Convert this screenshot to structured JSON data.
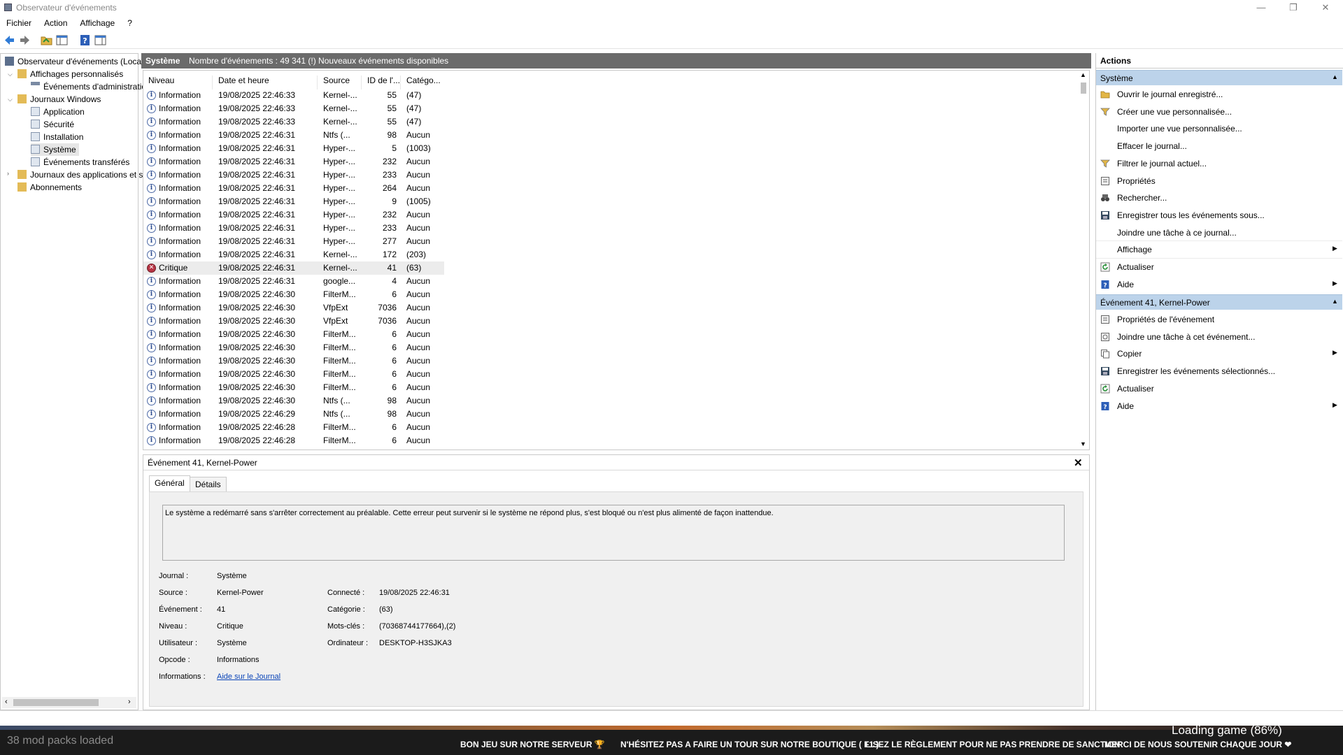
{
  "window": {
    "title": "Observateur d'événements",
    "minimize_label": "—",
    "restore_label": "❐",
    "close_label": "✕"
  },
  "menu": [
    "Fichier",
    "Action",
    "Affichage",
    "?"
  ],
  "tree": {
    "root": "Observateur d'événements (Local)",
    "custom_views": "Affichages personnalisés",
    "admin_events": "Événements d'administration",
    "windows_logs": "Journaux Windows",
    "application": "Application",
    "security": "Sécurité",
    "setup": "Installation",
    "system": "Système",
    "forwarded": "Événements transférés",
    "app_services_logs": "Journaux des applications et services",
    "subscriptions": "Abonnements"
  },
  "list_header": {
    "log_name": "Système",
    "summary": "Nombre d'événements : 49 341 (!) Nouveaux événements disponibles"
  },
  "columns": [
    "Niveau",
    "Date et heure",
    "Source",
    "ID de l'...",
    "Catégo..."
  ],
  "rows": [
    {
      "level": "Information",
      "date": "19/08/2025 22:46:33",
      "source": "Kernel-...",
      "id": "55",
      "cat": "(47)"
    },
    {
      "level": "Information",
      "date": "19/08/2025 22:46:33",
      "source": "Kernel-...",
      "id": "55",
      "cat": "(47)"
    },
    {
      "level": "Information",
      "date": "19/08/2025 22:46:33",
      "source": "Kernel-...",
      "id": "55",
      "cat": "(47)"
    },
    {
      "level": "Information",
      "date": "19/08/2025 22:46:31",
      "source": "Ntfs (...",
      "id": "98",
      "cat": "Aucun"
    },
    {
      "level": "Information",
      "date": "19/08/2025 22:46:31",
      "source": "Hyper-...",
      "id": "5",
      "cat": "(1003)"
    },
    {
      "level": "Information",
      "date": "19/08/2025 22:46:31",
      "source": "Hyper-...",
      "id": "232",
      "cat": "Aucun"
    },
    {
      "level": "Information",
      "date": "19/08/2025 22:46:31",
      "source": "Hyper-...",
      "id": "233",
      "cat": "Aucun"
    },
    {
      "level": "Information",
      "date": "19/08/2025 22:46:31",
      "source": "Hyper-...",
      "id": "264",
      "cat": "Aucun"
    },
    {
      "level": "Information",
      "date": "19/08/2025 22:46:31",
      "source": "Hyper-...",
      "id": "9",
      "cat": "(1005)"
    },
    {
      "level": "Information",
      "date": "19/08/2025 22:46:31",
      "source": "Hyper-...",
      "id": "232",
      "cat": "Aucun"
    },
    {
      "level": "Information",
      "date": "19/08/2025 22:46:31",
      "source": "Hyper-...",
      "id": "233",
      "cat": "Aucun"
    },
    {
      "level": "Information",
      "date": "19/08/2025 22:46:31",
      "source": "Hyper-...",
      "id": "277",
      "cat": "Aucun"
    },
    {
      "level": "Information",
      "date": "19/08/2025 22:46:31",
      "source": "Kernel-...",
      "id": "172",
      "cat": "(203)"
    },
    {
      "level": "Critique",
      "date": "19/08/2025 22:46:31",
      "source": "Kernel-...",
      "id": "41",
      "cat": "(63)"
    },
    {
      "level": "Information",
      "date": "19/08/2025 22:46:31",
      "source": "google...",
      "id": "4",
      "cat": "Aucun"
    },
    {
      "level": "Information",
      "date": "19/08/2025 22:46:30",
      "source": "FilterM...",
      "id": "6",
      "cat": "Aucun"
    },
    {
      "level": "Information",
      "date": "19/08/2025 22:46:30",
      "source": "VfpExt",
      "id": "7036",
      "cat": "Aucun"
    },
    {
      "level": "Information",
      "date": "19/08/2025 22:46:30",
      "source": "VfpExt",
      "id": "7036",
      "cat": "Aucun"
    },
    {
      "level": "Information",
      "date": "19/08/2025 22:46:30",
      "source": "FilterM...",
      "id": "6",
      "cat": "Aucun"
    },
    {
      "level": "Information",
      "date": "19/08/2025 22:46:30",
      "source": "FilterM...",
      "id": "6",
      "cat": "Aucun"
    },
    {
      "level": "Information",
      "date": "19/08/2025 22:46:30",
      "source": "FilterM...",
      "id": "6",
      "cat": "Aucun"
    },
    {
      "level": "Information",
      "date": "19/08/2025 22:46:30",
      "source": "FilterM...",
      "id": "6",
      "cat": "Aucun"
    },
    {
      "level": "Information",
      "date": "19/08/2025 22:46:30",
      "source": "FilterM...",
      "id": "6",
      "cat": "Aucun"
    },
    {
      "level": "Information",
      "date": "19/08/2025 22:46:30",
      "source": "Ntfs (...",
      "id": "98",
      "cat": "Aucun"
    },
    {
      "level": "Information",
      "date": "19/08/2025 22:46:29",
      "source": "Ntfs (...",
      "id": "98",
      "cat": "Aucun"
    },
    {
      "level": "Information",
      "date": "19/08/2025 22:46:28",
      "source": "FilterM...",
      "id": "6",
      "cat": "Aucun"
    },
    {
      "level": "Information",
      "date": "19/08/2025 22:46:28",
      "source": "FilterM...",
      "id": "6",
      "cat": "Aucun"
    }
  ],
  "detail": {
    "title": "Événement 41, Kernel-Power",
    "close_label": "✕",
    "tab_general": "Général",
    "tab_details": "Détails",
    "description": "Le système a redémarré sans s'arrêter correctement au préalable. Cette erreur peut survenir si le système ne répond plus, s'est bloqué ou n'est plus alimenté de façon inattendue.",
    "labels": {
      "journal": "Journal :",
      "source": "Source :",
      "event": "Événement :",
      "level": "Niveau :",
      "user": "Utilisateur :",
      "opcode": "Opcode :",
      "info": "Informations :",
      "logged": "Connecté :",
      "category": "Catégorie :",
      "keywords": "Mots-clés :",
      "computer": "Ordinateur :"
    },
    "values": {
      "journal": "Système",
      "source": "Kernel-Power",
      "event": "41",
      "level": "Critique",
      "user": "Système",
      "opcode": "Informations",
      "info_link": "Aide sur le Journal",
      "logged": "19/08/2025 22:46:31",
      "category": "(63)",
      "keywords": "(70368744177664),(2)",
      "computer": "DESKTOP-H3SJKA3"
    }
  },
  "actions": {
    "title": "Actions",
    "section1": "Système",
    "items1": [
      {
        "label": "Ouvrir le journal enregistré...",
        "icon": "folder-icon"
      },
      {
        "label": "Créer une vue personnalisée...",
        "icon": "filter-icon"
      },
      {
        "label": "Importer une vue personnalisée...",
        "icon": ""
      },
      {
        "label": "Effacer le journal...",
        "icon": ""
      },
      {
        "label": "Filtrer le journal actuel...",
        "icon": "filter-icon"
      },
      {
        "label": "Propriétés",
        "icon": "properties-icon"
      },
      {
        "label": "Rechercher...",
        "icon": "binoculars-icon"
      },
      {
        "label": "Enregistrer tous les événements sous...",
        "icon": "save-icon"
      },
      {
        "label": "Joindre une tâche à ce journal...",
        "icon": ""
      },
      {
        "label": "Affichage",
        "icon": "",
        "submenu": true
      },
      {
        "label": "Actualiser",
        "icon": "refresh-icon"
      },
      {
        "label": "Aide",
        "icon": "help-icon",
        "submenu": true
      }
    ],
    "section2": "Événement 41, Kernel-Power",
    "items2": [
      {
        "label": "Propriétés de l'événement",
        "icon": "properties-icon"
      },
      {
        "label": "Joindre une tâche à cet événement...",
        "icon": "task-icon"
      },
      {
        "label": "Copier",
        "icon": "copy-icon",
        "submenu": true
      },
      {
        "label": "Enregistrer les événements sélectionnés...",
        "icon": "save-icon"
      },
      {
        "label": "Actualiser",
        "icon": "refresh-icon"
      },
      {
        "label": "Aide",
        "icon": "help-icon",
        "submenu": true
      }
    ]
  },
  "overlay": {
    "mod_packs": "38 mod packs loaded",
    "loading": "Loading game (86%)",
    "ticker": [
      "BON JEU SUR NOTRE SERVEUR 🏆",
      "N'HÉSITEZ PAS A FAIRE UN TOUR SUR NOTRE BOUTIQUE ( F1 )",
      "LISEZ LE RÈGLEMENT POUR NE PAS PRENDRE DE SANCTION",
      "MERCI DE NOUS SOUTENIR CHAQUE JOUR ❤"
    ]
  },
  "colors": {
    "accent_header": "#bcd3ea",
    "list_header_bg": "#6b6b6b",
    "critical": "#b83545",
    "link": "#0b45b8"
  }
}
